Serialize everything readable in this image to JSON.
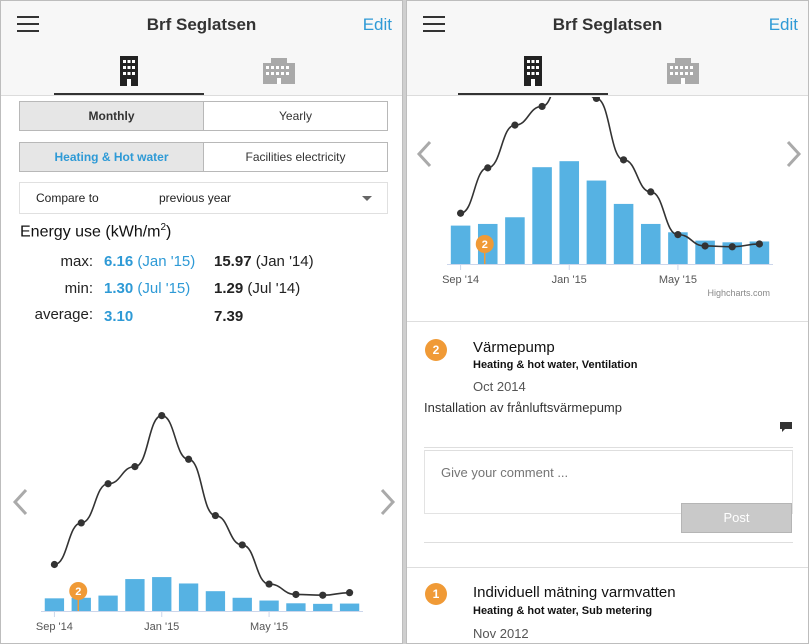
{
  "app": {
    "title": "Brf Seglatsen",
    "edit_label": "Edit",
    "menu_icon": "hamburger-menu-icon",
    "tabs": [
      {
        "icon": "building-icon",
        "active": true
      },
      {
        "icon": "apartment-block-icon",
        "active": false
      }
    ]
  },
  "left": {
    "period_options": [
      "Monthly",
      "Yearly"
    ],
    "period_selected": "Monthly",
    "category_options": [
      "Heating & Hot water",
      "Facilities electricity"
    ],
    "category_selected": "Heating & Hot water",
    "compare": {
      "label": "Compare to",
      "value": "previous year"
    },
    "energy": {
      "title_prefix": "Energy use (kWh/m",
      "title_sup": "2",
      "title_suffix": ")",
      "rows": [
        {
          "label": "max:",
          "current_value": "6.16",
          "current_period": "(Jan '15)",
          "previous_value": "15.97",
          "previous_period": "(Jan '14)"
        },
        {
          "label": "min:",
          "current_value": "1.30",
          "current_period": "(Jul '15)",
          "previous_value": "1.29",
          "previous_period": "(Jul '14)"
        },
        {
          "label": "average:",
          "current_value": "3.10",
          "current_period": "",
          "previous_value": "7.39",
          "previous_period": ""
        }
      ]
    }
  },
  "right": {
    "credits": "Highcharts.com",
    "notes": [
      {
        "number": "2",
        "title": "Värmepump",
        "tags": "Heating & hot water, Ventilation",
        "date": "Oct 2014",
        "description": "Installation av frånluftsvärmepump",
        "comment_placeholder": "Give your comment ...",
        "post_label": "Post"
      },
      {
        "number": "1",
        "title": "Individuell mätning varmvatten",
        "tags": "Heating & hot water, Sub metering",
        "date": "Nov 2012"
      }
    ]
  },
  "colors": {
    "bar": "#56b2e3",
    "line": "#333333",
    "accent": "#2e9ad6",
    "marker": "#f09a36"
  },
  "chart_data": {
    "type": "bar",
    "categories": [
      "Sep '14",
      "Oct '14",
      "Nov '14",
      "Dec '14",
      "Jan '15",
      "Feb '15",
      "Mar '15",
      "Apr '15",
      "May '15",
      "Jun '15",
      "Jul '15",
      "Aug '15"
    ],
    "x_tick_labels": [
      "Sep '14",
      "Jan '15",
      "May '15"
    ],
    "series": [
      {
        "values": [
          2.3,
          2.4,
          2.8,
          5.8,
          6.16,
          5.0,
          3.6,
          2.4,
          1.9,
          1.4,
          1.3,
          1.35
        ]
      },
      {
        "type": "line",
        "values": [
          3.8,
          7.2,
          10.4,
          11.8,
          15.97,
          12.4,
          7.8,
          5.4,
          2.2,
          1.35,
          1.29,
          1.5
        ]
      }
    ],
    "marker": {
      "label": "2",
      "category": "Oct '14"
    },
    "ylim": [
      0,
      17
    ]
  }
}
